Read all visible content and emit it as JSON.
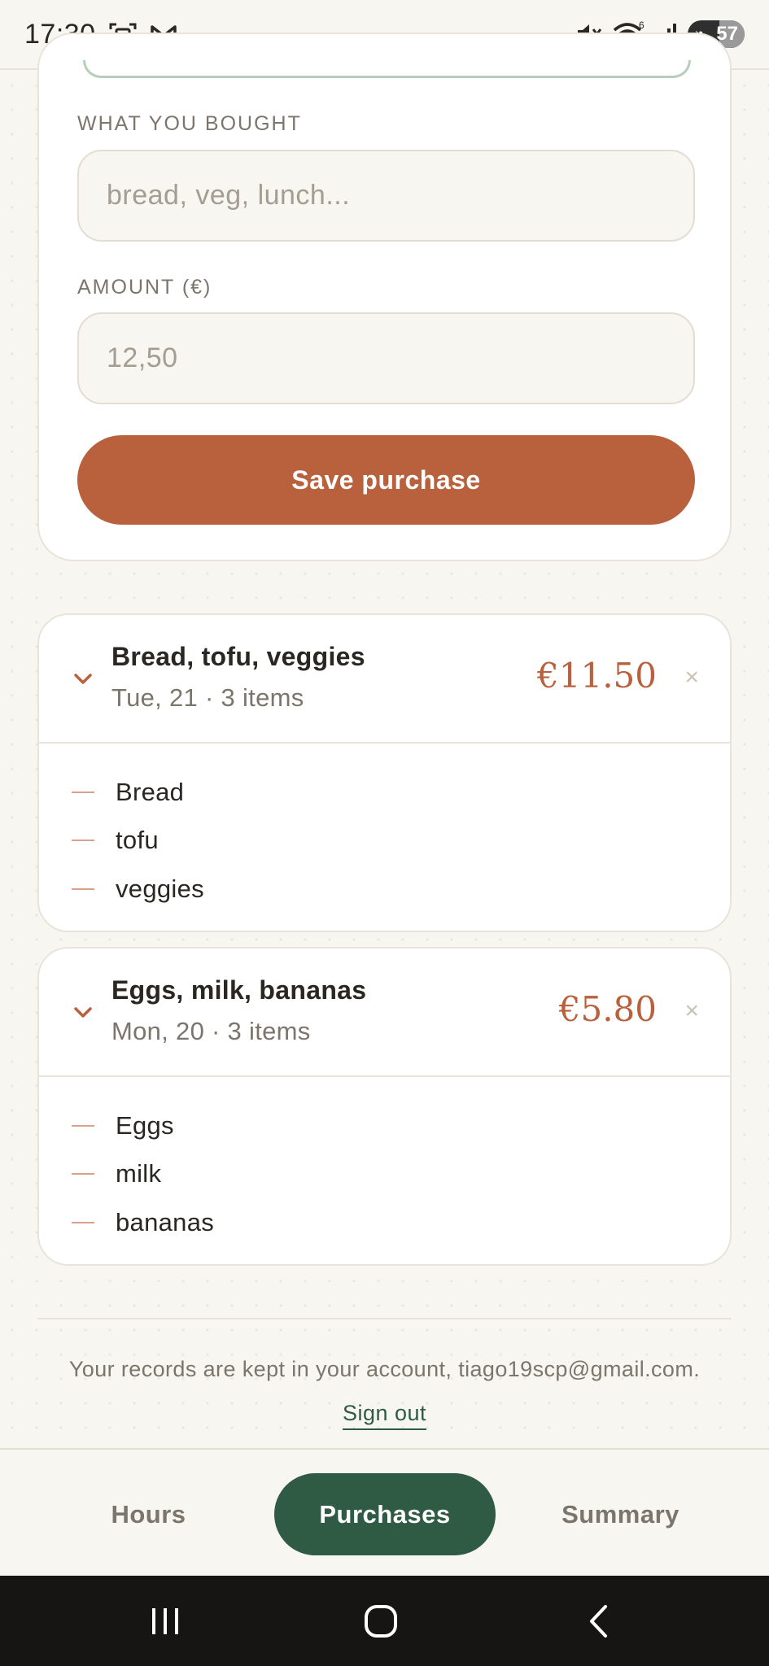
{
  "status_bar": {
    "time": "17:30",
    "battery": "57",
    "icons": [
      "screenshot-icon",
      "gmail-icon",
      "mute-icon",
      "wifi-icon",
      "signal-icon",
      "battery-icon"
    ],
    "wifi_badge": "6"
  },
  "form": {
    "item_label": "WHAT YOU BOUGHT",
    "item_placeholder": "bread, veg, lunch...",
    "amount_label": "AMOUNT (€)",
    "amount_placeholder": "12,50",
    "save_label": "Save purchase"
  },
  "purchases": [
    {
      "title": "Bread, tofu, veggies",
      "meta": "Tue, 21 · 3 items",
      "total": "€11.50",
      "delete": "×",
      "items": [
        "Bread",
        "tofu",
        "veggies"
      ]
    },
    {
      "title": "Eggs, milk, bananas",
      "meta": "Mon, 20 · 3 items",
      "total": "€5.80",
      "delete": "×",
      "items": [
        "Eggs",
        "milk",
        "bananas"
      ]
    }
  ],
  "footer": {
    "note": "Your records are kept in your account, tiago19scp@gmail.com.",
    "sign_out": "Sign out"
  },
  "tabs": {
    "hours": "Hours",
    "purchases": "Purchases",
    "summary": "Summary",
    "active": "purchases"
  },
  "colors": {
    "accent": "#b8613c",
    "brand_green": "#2f5a43",
    "background": "#f8f6f1"
  }
}
